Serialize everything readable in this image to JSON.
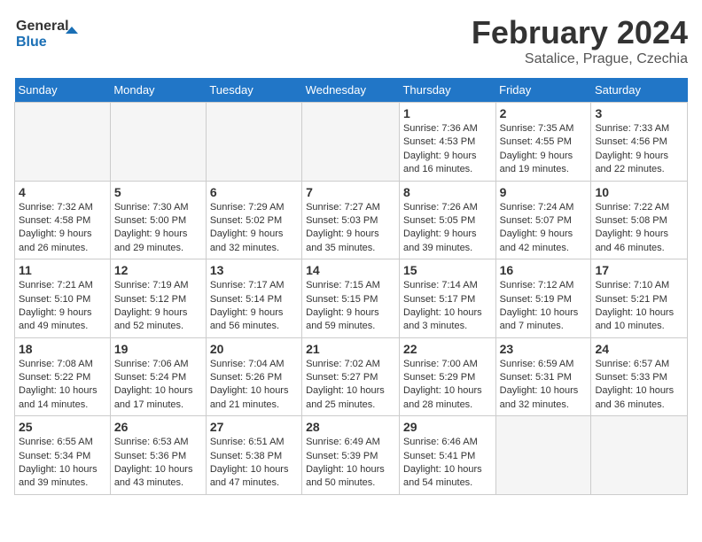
{
  "header": {
    "logo_general": "General",
    "logo_blue": "Blue",
    "month_year": "February 2024",
    "location": "Satalice, Prague, Czechia"
  },
  "days_of_week": [
    "Sunday",
    "Monday",
    "Tuesday",
    "Wednesday",
    "Thursday",
    "Friday",
    "Saturday"
  ],
  "weeks": [
    [
      {
        "day": "",
        "info": ""
      },
      {
        "day": "",
        "info": ""
      },
      {
        "day": "",
        "info": ""
      },
      {
        "day": "",
        "info": ""
      },
      {
        "day": "1",
        "info": "Sunrise: 7:36 AM\nSunset: 4:53 PM\nDaylight: 9 hours and 16 minutes."
      },
      {
        "day": "2",
        "info": "Sunrise: 7:35 AM\nSunset: 4:55 PM\nDaylight: 9 hours and 19 minutes."
      },
      {
        "day": "3",
        "info": "Sunrise: 7:33 AM\nSunset: 4:56 PM\nDaylight: 9 hours and 22 minutes."
      }
    ],
    [
      {
        "day": "4",
        "info": "Sunrise: 7:32 AM\nSunset: 4:58 PM\nDaylight: 9 hours and 26 minutes."
      },
      {
        "day": "5",
        "info": "Sunrise: 7:30 AM\nSunset: 5:00 PM\nDaylight: 9 hours and 29 minutes."
      },
      {
        "day": "6",
        "info": "Sunrise: 7:29 AM\nSunset: 5:02 PM\nDaylight: 9 hours and 32 minutes."
      },
      {
        "day": "7",
        "info": "Sunrise: 7:27 AM\nSunset: 5:03 PM\nDaylight: 9 hours and 35 minutes."
      },
      {
        "day": "8",
        "info": "Sunrise: 7:26 AM\nSunset: 5:05 PM\nDaylight: 9 hours and 39 minutes."
      },
      {
        "day": "9",
        "info": "Sunrise: 7:24 AM\nSunset: 5:07 PM\nDaylight: 9 hours and 42 minutes."
      },
      {
        "day": "10",
        "info": "Sunrise: 7:22 AM\nSunset: 5:08 PM\nDaylight: 9 hours and 46 minutes."
      }
    ],
    [
      {
        "day": "11",
        "info": "Sunrise: 7:21 AM\nSunset: 5:10 PM\nDaylight: 9 hours and 49 minutes."
      },
      {
        "day": "12",
        "info": "Sunrise: 7:19 AM\nSunset: 5:12 PM\nDaylight: 9 hours and 52 minutes."
      },
      {
        "day": "13",
        "info": "Sunrise: 7:17 AM\nSunset: 5:14 PM\nDaylight: 9 hours and 56 minutes."
      },
      {
        "day": "14",
        "info": "Sunrise: 7:15 AM\nSunset: 5:15 PM\nDaylight: 9 hours and 59 minutes."
      },
      {
        "day": "15",
        "info": "Sunrise: 7:14 AM\nSunset: 5:17 PM\nDaylight: 10 hours and 3 minutes."
      },
      {
        "day": "16",
        "info": "Sunrise: 7:12 AM\nSunset: 5:19 PM\nDaylight: 10 hours and 7 minutes."
      },
      {
        "day": "17",
        "info": "Sunrise: 7:10 AM\nSunset: 5:21 PM\nDaylight: 10 hours and 10 minutes."
      }
    ],
    [
      {
        "day": "18",
        "info": "Sunrise: 7:08 AM\nSunset: 5:22 PM\nDaylight: 10 hours and 14 minutes."
      },
      {
        "day": "19",
        "info": "Sunrise: 7:06 AM\nSunset: 5:24 PM\nDaylight: 10 hours and 17 minutes."
      },
      {
        "day": "20",
        "info": "Sunrise: 7:04 AM\nSunset: 5:26 PM\nDaylight: 10 hours and 21 minutes."
      },
      {
        "day": "21",
        "info": "Sunrise: 7:02 AM\nSunset: 5:27 PM\nDaylight: 10 hours and 25 minutes."
      },
      {
        "day": "22",
        "info": "Sunrise: 7:00 AM\nSunset: 5:29 PM\nDaylight: 10 hours and 28 minutes."
      },
      {
        "day": "23",
        "info": "Sunrise: 6:59 AM\nSunset: 5:31 PM\nDaylight: 10 hours and 32 minutes."
      },
      {
        "day": "24",
        "info": "Sunrise: 6:57 AM\nSunset: 5:33 PM\nDaylight: 10 hours and 36 minutes."
      }
    ],
    [
      {
        "day": "25",
        "info": "Sunrise: 6:55 AM\nSunset: 5:34 PM\nDaylight: 10 hours and 39 minutes."
      },
      {
        "day": "26",
        "info": "Sunrise: 6:53 AM\nSunset: 5:36 PM\nDaylight: 10 hours and 43 minutes."
      },
      {
        "day": "27",
        "info": "Sunrise: 6:51 AM\nSunset: 5:38 PM\nDaylight: 10 hours and 47 minutes."
      },
      {
        "day": "28",
        "info": "Sunrise: 6:49 AM\nSunset: 5:39 PM\nDaylight: 10 hours and 50 minutes."
      },
      {
        "day": "29",
        "info": "Sunrise: 6:46 AM\nSunset: 5:41 PM\nDaylight: 10 hours and 54 minutes."
      },
      {
        "day": "",
        "info": ""
      },
      {
        "day": "",
        "info": ""
      }
    ]
  ]
}
